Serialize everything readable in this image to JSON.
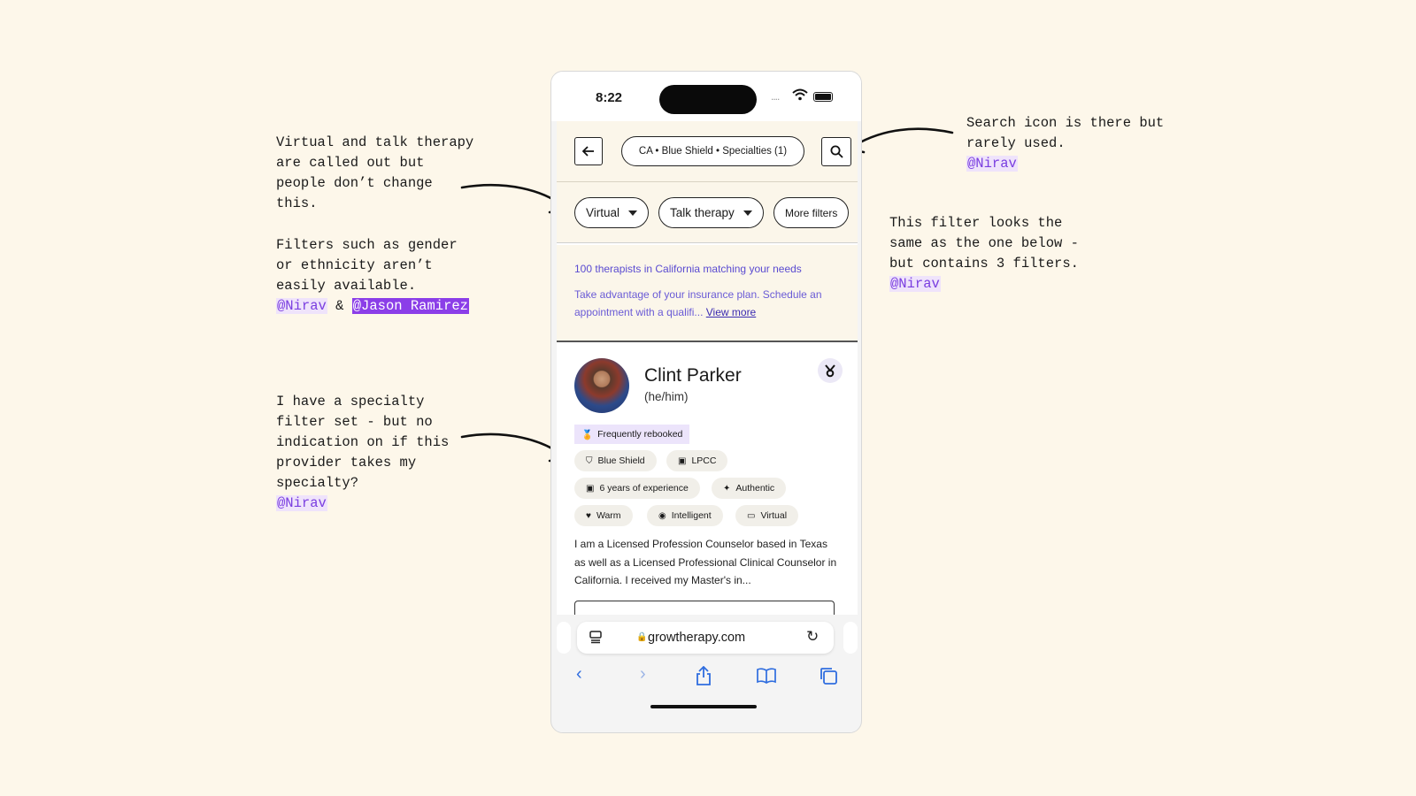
{
  "annotations": {
    "virtual_note": "Virtual and talk therapy\nare called out but\npeople don’t change\nthis.",
    "filters_note": "Filters such as gender\nor ethnicity aren’t\neasily available.",
    "filters_mention1": "@Nirav",
    "filters_amp": "&",
    "filters_mention2": "@Jason Ramirez",
    "specialty_note": "I have a specialty\nfilter set - but no\nindication on if this\nprovider takes my\nspecialty?",
    "specialty_mention": "@Nirav",
    "search_note": "Search icon is there but\nrarely used.",
    "search_mention": "@Nirav",
    "filter_note": "This filter looks the\nsame as the one below -\nbut contains 3 filters.",
    "filter_mention": "@Nirav"
  },
  "status_bar": {
    "time": "8:22",
    "signal": "....",
    "wifi_icon": "wifi-icon",
    "battery_icon": "battery-icon"
  },
  "search_header": {
    "back_icon": "arrow-left-icon",
    "search_summary": "CA • Blue Shield • Specialties (1)",
    "search_icon": "search-icon"
  },
  "filter_chips": [
    {
      "label": "Virtual"
    },
    {
      "label": "Talk therapy"
    },
    {
      "label": "More filters"
    }
  ],
  "results": {
    "title": "100 therapists in California matching your needs",
    "description": "Take advantage of your insurance plan. Schedule an appointment with a qualifi...",
    "view_more": "View more"
  },
  "provider": {
    "name": "Clint Parker",
    "pronouns": "(he/him)",
    "badge": "Frequently rebooked",
    "tags": [
      "Blue Shield",
      "LPCC",
      "6 years of experience",
      "Authentic",
      "Warm",
      "Intelligent",
      "Virtual"
    ],
    "bio": "I am a Licensed Profession Counselor based in Texas as well as a Licensed Professional Clinical Counselor in California. I received my Master's in..."
  },
  "browser": {
    "url": "growtherapy.com",
    "nav_icons": [
      "back-icon",
      "forward-icon",
      "share-icon",
      "bookmarks-icon",
      "tabs-icon"
    ]
  },
  "colors": {
    "background": "#fdf7ea",
    "accent": "#5a4bd1",
    "mention": "#7a3ee0"
  }
}
